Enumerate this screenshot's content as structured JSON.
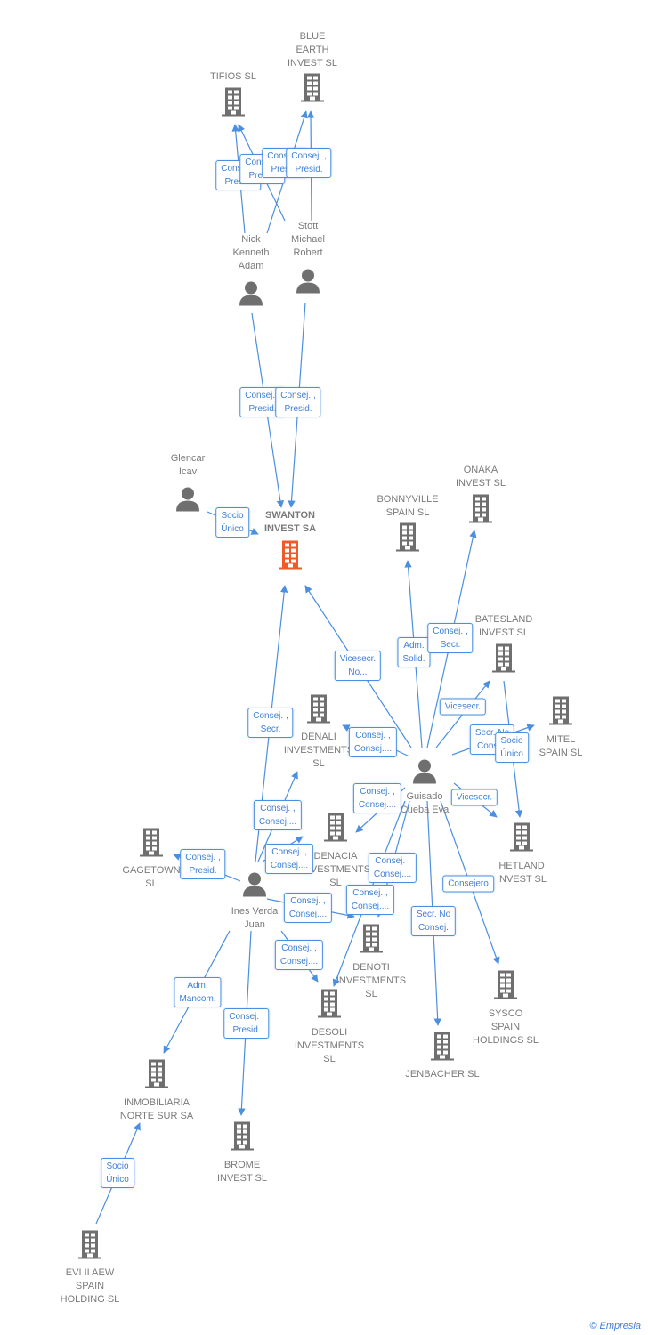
{
  "colors": {
    "edge": "#4a8fe0",
    "node": "#6f6f6f",
    "main": "#f05a28"
  },
  "nodes": [
    {
      "id": "tifios",
      "name": "TIFIOS  SL",
      "type": "company"
    },
    {
      "id": "blue",
      "name": "BLUE\nEARTH\nINVEST  SL",
      "type": "company"
    },
    {
      "id": "nick",
      "name": "Nick\nKenneth\nAdam",
      "type": "person"
    },
    {
      "id": "stott",
      "name": "Stott\nMichael\nRobert",
      "type": "person"
    },
    {
      "id": "glencar",
      "name": "Glencar\nIcav",
      "type": "person"
    },
    {
      "id": "swanton",
      "name": "SWANTON\nINVEST SA",
      "type": "main"
    },
    {
      "id": "onaka",
      "name": "ONAKA\nINVEST  SL",
      "type": "company"
    },
    {
      "id": "bonnyville",
      "name": "BONNYVILLE\nSPAIN  SL",
      "type": "company"
    },
    {
      "id": "batesland",
      "name": "BATESLAND\nINVEST  SL",
      "type": "company"
    },
    {
      "id": "mitel",
      "name": "MITEL\nSPAIN  SL",
      "type": "company"
    },
    {
      "id": "denali",
      "name": "DENALI\nINVESTMENTS\nSL",
      "type": "company"
    },
    {
      "id": "guisado",
      "name": "Guisado\nCueba Eva",
      "type": "person"
    },
    {
      "id": "gagetown",
      "name": "GAGETOWN\nSL",
      "type": "company"
    },
    {
      "id": "denacia",
      "name": "DENACIA\nINVESTMENTS\nSL",
      "type": "company"
    },
    {
      "id": "hetland",
      "name": "HETLAND\nINVEST  SL",
      "type": "company"
    },
    {
      "id": "ines",
      "name": "Ines Verda\nJuan",
      "type": "person"
    },
    {
      "id": "denoti",
      "name": "DENOTI\nINVESTMENTS\nSL",
      "type": "company"
    },
    {
      "id": "sysco",
      "name": "SYSCO\nSPAIN\nHOLDINGS  SL",
      "type": "company"
    },
    {
      "id": "desoli",
      "name": "DESOLI\nINVESTMENTS\nSL",
      "type": "company"
    },
    {
      "id": "jenbacher",
      "name": "JENBACHER SL",
      "type": "company"
    },
    {
      "id": "inmobiliaria",
      "name": "INMOBILIARIA\nNORTE SUR SA",
      "type": "company"
    },
    {
      "id": "brome",
      "name": "BROME\nINVEST  SL",
      "type": "company"
    },
    {
      "id": "evi",
      "name": "EVI II AEW\nSPAIN\nHOLDING  SL",
      "type": "company"
    }
  ],
  "edges": [
    {
      "from": "nick",
      "to": "tifios",
      "label": "Consej. ,\nPresid."
    },
    {
      "from": "stott",
      "to": "tifios",
      "label": "Consej. ,\nPresid."
    },
    {
      "from": "nick",
      "to": "blue",
      "label": "Consej. ,\nPresid."
    },
    {
      "from": "stott",
      "to": "blue",
      "label": "Consej. ,\nPresid."
    },
    {
      "from": "nick",
      "to": "swanton",
      "label": "Consej. ,\nPresid."
    },
    {
      "from": "stott",
      "to": "swanton",
      "label": "Consej. ,\nPresid."
    },
    {
      "from": "glencar",
      "to": "swanton",
      "label": "Socio\nÚnico"
    },
    {
      "from": "ines",
      "to": "swanton",
      "label": "Consej. ,\nSecr."
    },
    {
      "from": "guisado",
      "to": "swanton",
      "label": "Vicesecr.\nNo..."
    },
    {
      "from": "guisado",
      "to": "bonnyville",
      "label": "Adm.\nSolid."
    },
    {
      "from": "guisado",
      "to": "onaka",
      "label": "Consej. ,\nSecr."
    },
    {
      "from": "guisado",
      "to": "batesland",
      "label": "Vicesecr."
    },
    {
      "from": "guisado",
      "to": "mitel",
      "label": "Secr.  No\nConsej."
    },
    {
      "from": "batesland",
      "to": "hetland",
      "label": "Socio\nÚnico"
    },
    {
      "from": "guisado",
      "to": "denali",
      "label": "Consej. ,\nConsej...."
    },
    {
      "from": "guisado",
      "to": "hetland",
      "label": "Vicesecr."
    },
    {
      "from": "guisado",
      "to": "denacia",
      "label": "Consej. ,\nConsej...."
    },
    {
      "from": "guisado",
      "to": "denoti",
      "label": "Consej. ,\nConsej...."
    },
    {
      "from": "guisado",
      "to": "desoli",
      "label": "Consej. ,\nConsej...."
    },
    {
      "from": "guisado",
      "to": "jenbacher",
      "label": "Secr.  No\nConsej."
    },
    {
      "from": "guisado",
      "to": "sysco",
      "label": "Consejero"
    },
    {
      "from": "ines",
      "to": "denali",
      "label": "Consej. ,\nConsej...."
    },
    {
      "from": "ines",
      "to": "denacia",
      "label": "Consej. ,\nConsej...."
    },
    {
      "from": "ines",
      "to": "gagetown",
      "label": "Consej. ,\nPresid."
    },
    {
      "from": "ines",
      "to": "denoti",
      "label": "Consej. ,\nConsej...."
    },
    {
      "from": "ines",
      "to": "desoli",
      "label": "Consej. ,\nConsej...."
    },
    {
      "from": "ines",
      "to": "inmobiliaria",
      "label": "Adm.\nMancom."
    },
    {
      "from": "ines",
      "to": "brome",
      "label": "Consej. ,\nPresid."
    },
    {
      "from": "evi",
      "to": "inmobiliaria",
      "label": "Socio\nÚnico"
    }
  ],
  "footer": {
    "copyright": "©",
    "brand": "Empresia"
  }
}
